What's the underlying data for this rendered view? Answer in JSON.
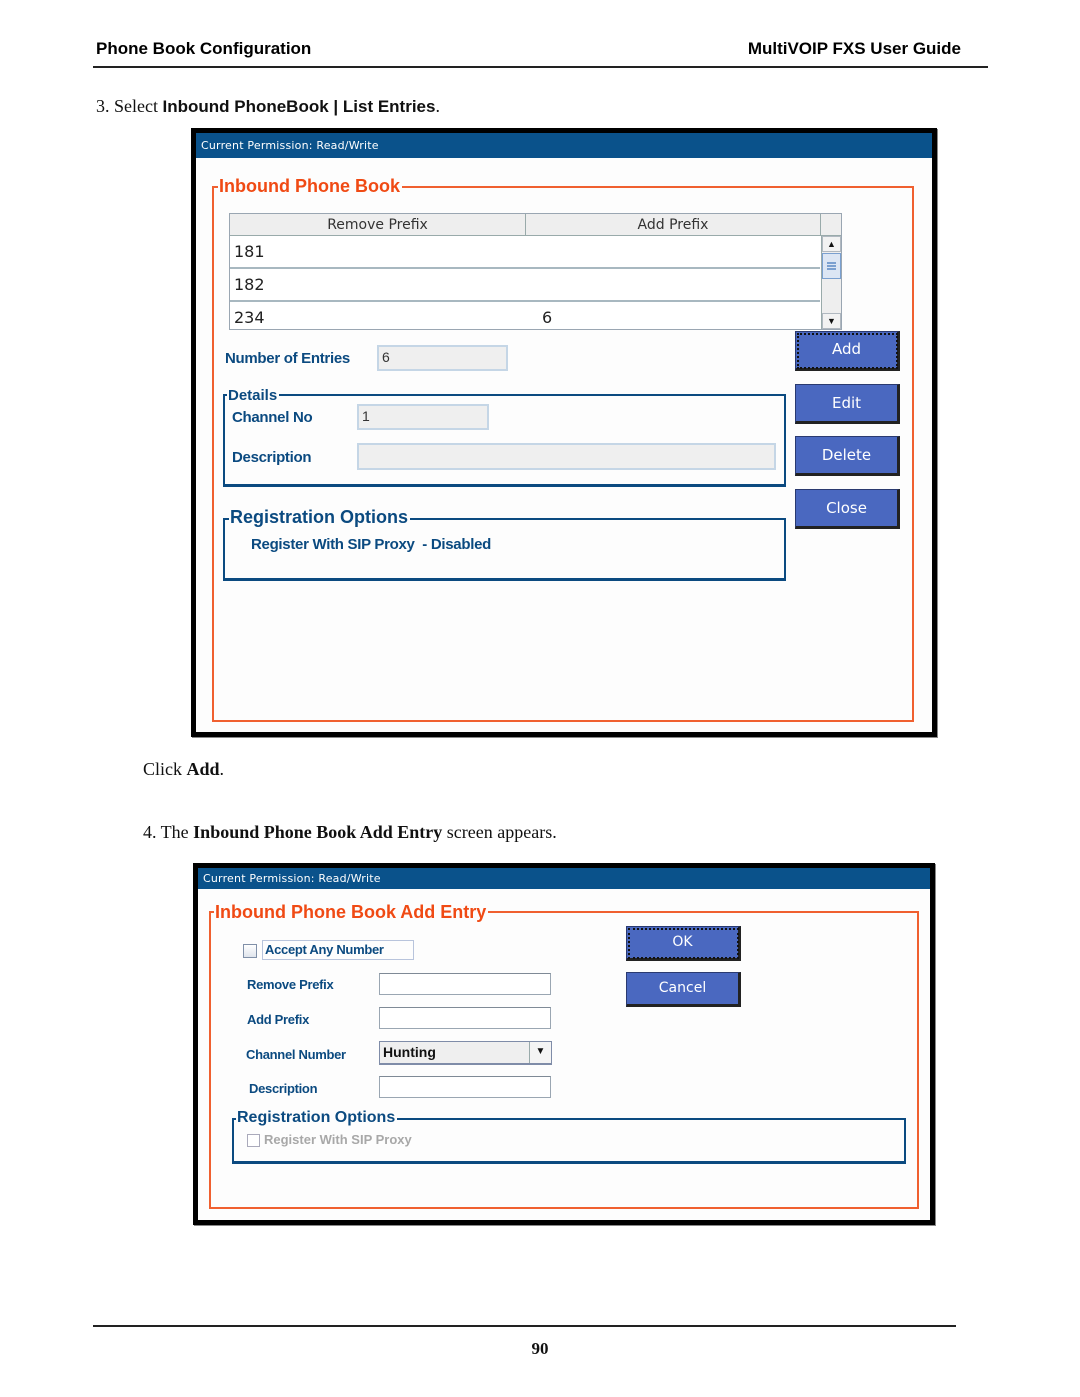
{
  "page_header": {
    "left": "Phone Book Configuration",
    "right": "MultiVOIP FXS User Guide"
  },
  "step3": {
    "prefix": "3. Select ",
    "menu_path": "Inbound PhoneBook | List Entries",
    "suffix": "."
  },
  "screen1": {
    "permission": "Current Permission:  Read/Write",
    "group_title": "Inbound Phone Book",
    "table": {
      "columns": [
        "Remove Prefix",
        "Add Prefix"
      ],
      "rows": [
        {
          "remove_prefix": "181",
          "add_prefix": ""
        },
        {
          "remove_prefix": "182",
          "add_prefix": ""
        },
        {
          "remove_prefix": "234",
          "add_prefix": "6"
        }
      ],
      "scroll_up_icon": "▲",
      "scroll_down_icon": "▼"
    },
    "number_of_entries_label": "Number of Entries",
    "number_of_entries_value": "6",
    "details": {
      "title": "Details",
      "channel_no_label": "Channel No",
      "channel_no_value": "1",
      "description_label": "Description",
      "description_value": ""
    },
    "registration": {
      "title": "Registration Options",
      "status": "Register With SIP Proxy  - Disabled"
    },
    "buttons": {
      "add": "Add",
      "edit": "Edit",
      "delete": "Delete",
      "close": "Close"
    }
  },
  "click_add": {
    "prefix": "Click ",
    "bold": "Add",
    "suffix": "."
  },
  "step4": {
    "prefix": "4. The ",
    "bold": "Inbound Phone Book Add Entry",
    "suffix": " screen appears."
  },
  "screen2": {
    "permission": "Current Permission:  Read/Write",
    "group_title": "Inbound Phone Book Add Entry",
    "accept_any_number_label": "Accept Any Number",
    "accept_any_number_checked": false,
    "remove_prefix_label": "Remove Prefix",
    "remove_prefix_value": "",
    "add_prefix_label": "Add Prefix",
    "add_prefix_value": "",
    "channel_number_label": "Channel Number",
    "channel_number_value": "Hunting",
    "dropdown_icon": "▼",
    "description_label": "Description",
    "description_value": "",
    "registration": {
      "title": "Registration Options",
      "register_label": "Register With SIP Proxy",
      "register_checked": false
    },
    "buttons": {
      "ok": "OK",
      "cancel": "Cancel"
    }
  },
  "page_number": "90",
  "colors": {
    "title_bar": "#0a528b",
    "orange_title": "#f04a14",
    "blue_label": "#0b4a80",
    "button": "#4a68c0"
  }
}
